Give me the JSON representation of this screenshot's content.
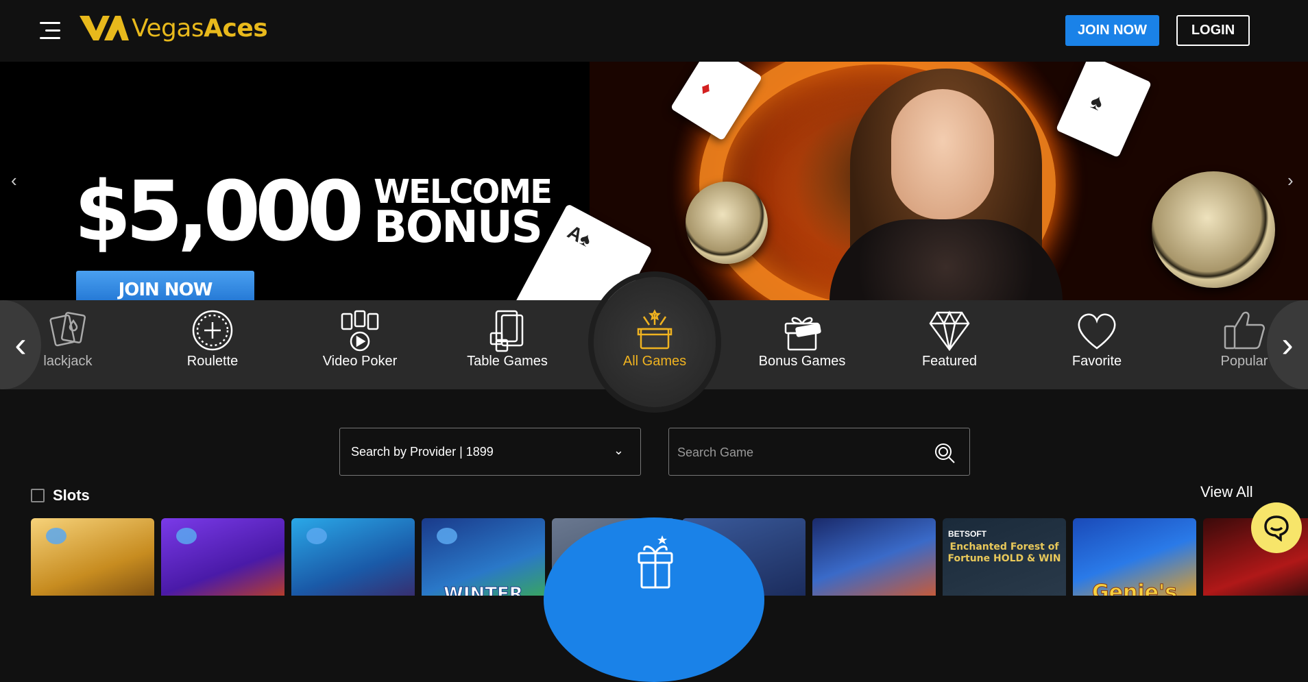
{
  "header": {
    "logo_vegas": "Vegas",
    "logo_aces": "Aces",
    "join_label": "JOIN NOW",
    "login_label": "LOGIN"
  },
  "banner": {
    "amount": "$5,000",
    "welcome_line1": "WELCOME",
    "welcome_line2": "BONUS",
    "join_label": "JOIN NOW"
  },
  "categories": [
    {
      "label": "lackjack",
      "icon": "blackjack-cards-icon"
    },
    {
      "label": "Roulette",
      "icon": "roulette-icon"
    },
    {
      "label": "Video Poker",
      "icon": "video-poker-icon"
    },
    {
      "label": "Table Games",
      "icon": "table-games-icon"
    },
    {
      "label": "All Games",
      "icon": "all-games-icon",
      "active": true
    },
    {
      "label": "Bonus Games",
      "icon": "bonus-gift-icon"
    },
    {
      "label": "Featured",
      "icon": "diamond-icon"
    },
    {
      "label": "Favorite",
      "icon": "heart-icon"
    },
    {
      "label": "Popular",
      "icon": "thumbs-up-icon"
    }
  ],
  "filters": {
    "provider_label": "Search by Provider | 1899",
    "search_placeholder": "Search Game"
  },
  "slots": {
    "title": "Slots",
    "view_all": "View All",
    "games": [
      {
        "caption": ""
      },
      {
        "caption": ""
      },
      {
        "caption": ""
      },
      {
        "caption": "WINTER"
      },
      {
        "caption": ""
      },
      {
        "caption": ""
      },
      {
        "caption": ""
      },
      {
        "caption": "Enchanted Forest of Fortune HOLD & WIN",
        "brand": "BETSOFT"
      },
      {
        "caption": "Genie's"
      },
      {
        "caption": ""
      }
    ]
  },
  "colors": {
    "accent_gold": "#f0b320",
    "brand_blue": "#1a82e8",
    "background": "#111111",
    "category_bar": "#2a2a2a",
    "chat_button": "#f7e56a"
  }
}
